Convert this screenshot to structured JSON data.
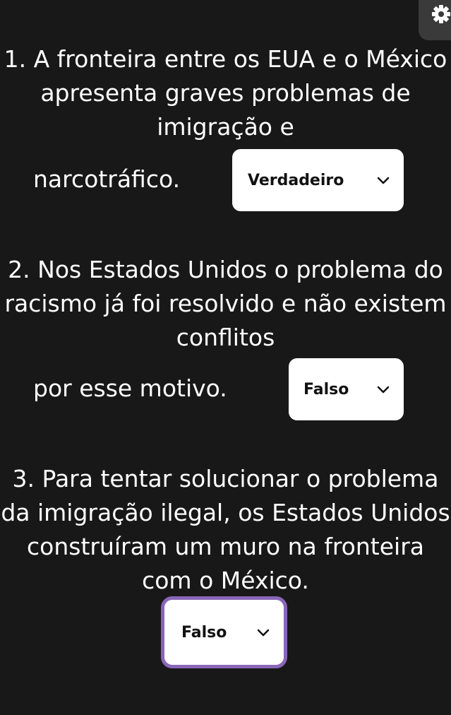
{
  "questions": [
    {
      "text": "1. A fronteira entre os EUA e o México apresenta graves problemas de imigração e",
      "last_line": "narcotráfico.",
      "answer": "Verdadeiro"
    },
    {
      "text": "2. Nos Estados Unidos o problema do racismo já foi resolvido e não existem conflitos",
      "last_line": "por esse motivo.",
      "answer": "Falso"
    },
    {
      "text": "3. Para tentar solucionar o problema da imigração ilegal, os Estados Unidos construíram um muro na fronteira com o México.",
      "answer": "Falso"
    }
  ],
  "icons": {
    "settings": "gear-icon",
    "dropdown": "chevron-down-icon"
  },
  "colors": {
    "background": "#181818",
    "focus_ring": "#8a66b8",
    "settings_bg": "#3a3a3a"
  }
}
